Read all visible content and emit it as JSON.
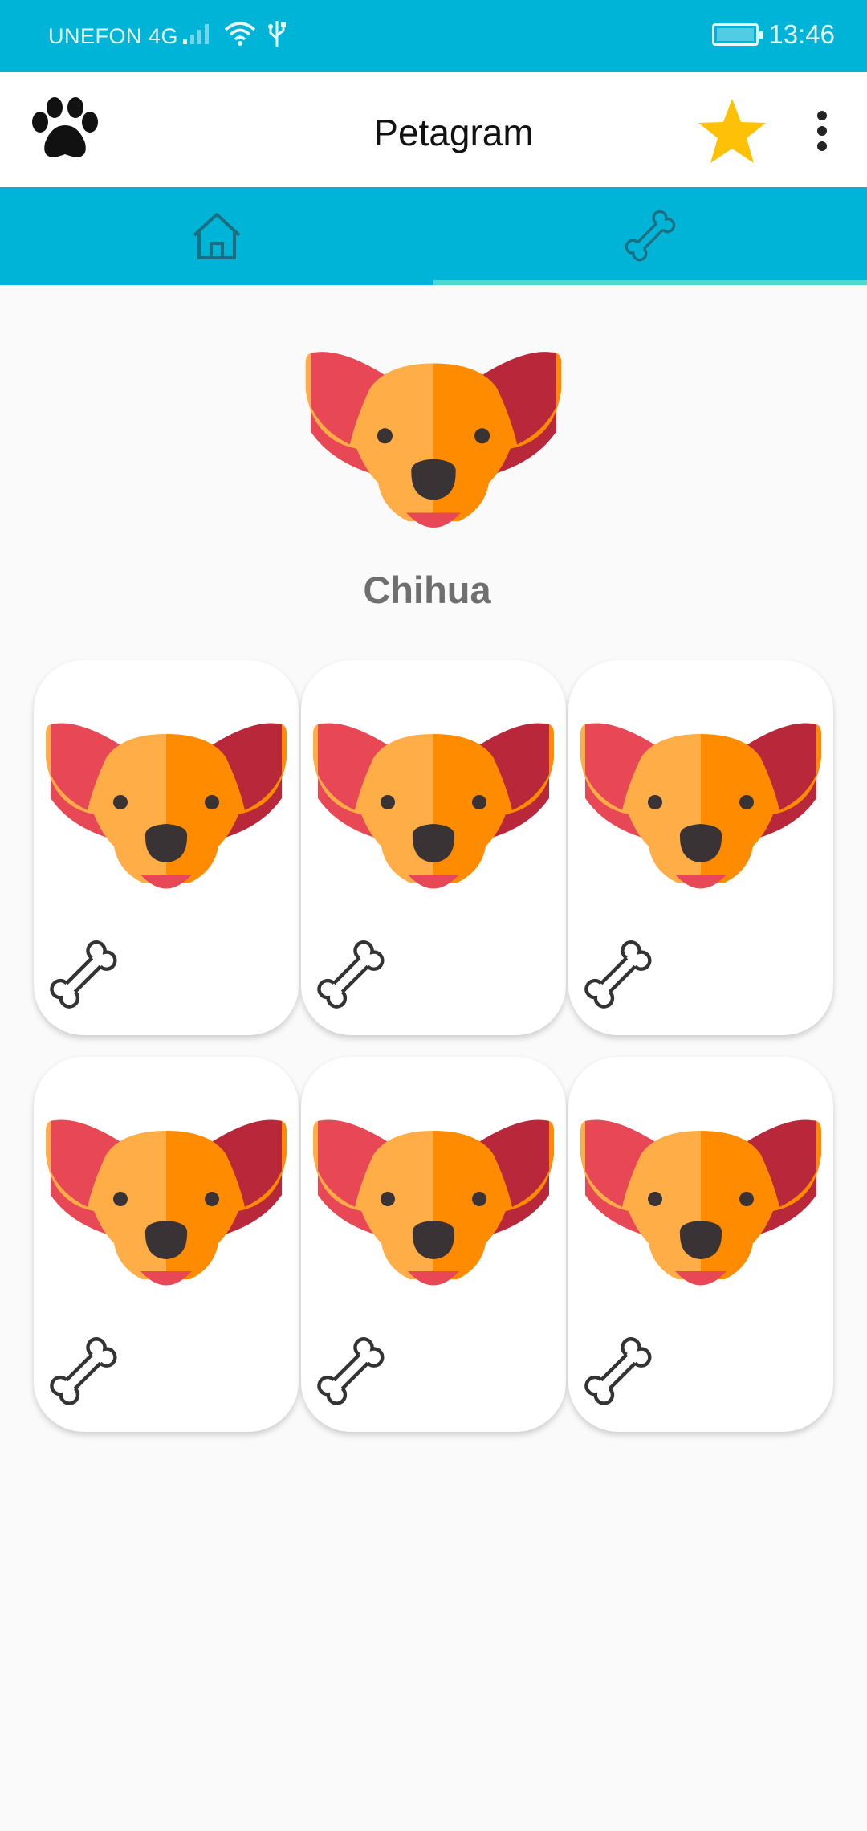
{
  "status_bar": {
    "carrier": "UNEFON 4G",
    "time": "13:46",
    "icons": [
      "signal-icon",
      "wifi-icon",
      "usb-icon",
      "battery-icon"
    ]
  },
  "app_bar": {
    "title": "Petagram",
    "icons": [
      "paw-icon",
      "star-icon",
      "more-vert-icon"
    ]
  },
  "tabs": [
    {
      "icon": "home-icon",
      "selected": false
    },
    {
      "icon": "bone-icon",
      "selected": true
    }
  ],
  "profile": {
    "name": "Chihua"
  },
  "gallery": {
    "items": [
      {
        "icon": "bone-icon"
      },
      {
        "icon": "bone-icon"
      },
      {
        "icon": "bone-icon"
      },
      {
        "icon": "bone-icon"
      },
      {
        "icon": "bone-icon"
      },
      {
        "icon": "bone-icon"
      }
    ]
  },
  "colors": {
    "primary": "#00b4d8",
    "tab_indicator": "#4dd9d0",
    "star": "#ffc107",
    "background": "#fafafa"
  }
}
